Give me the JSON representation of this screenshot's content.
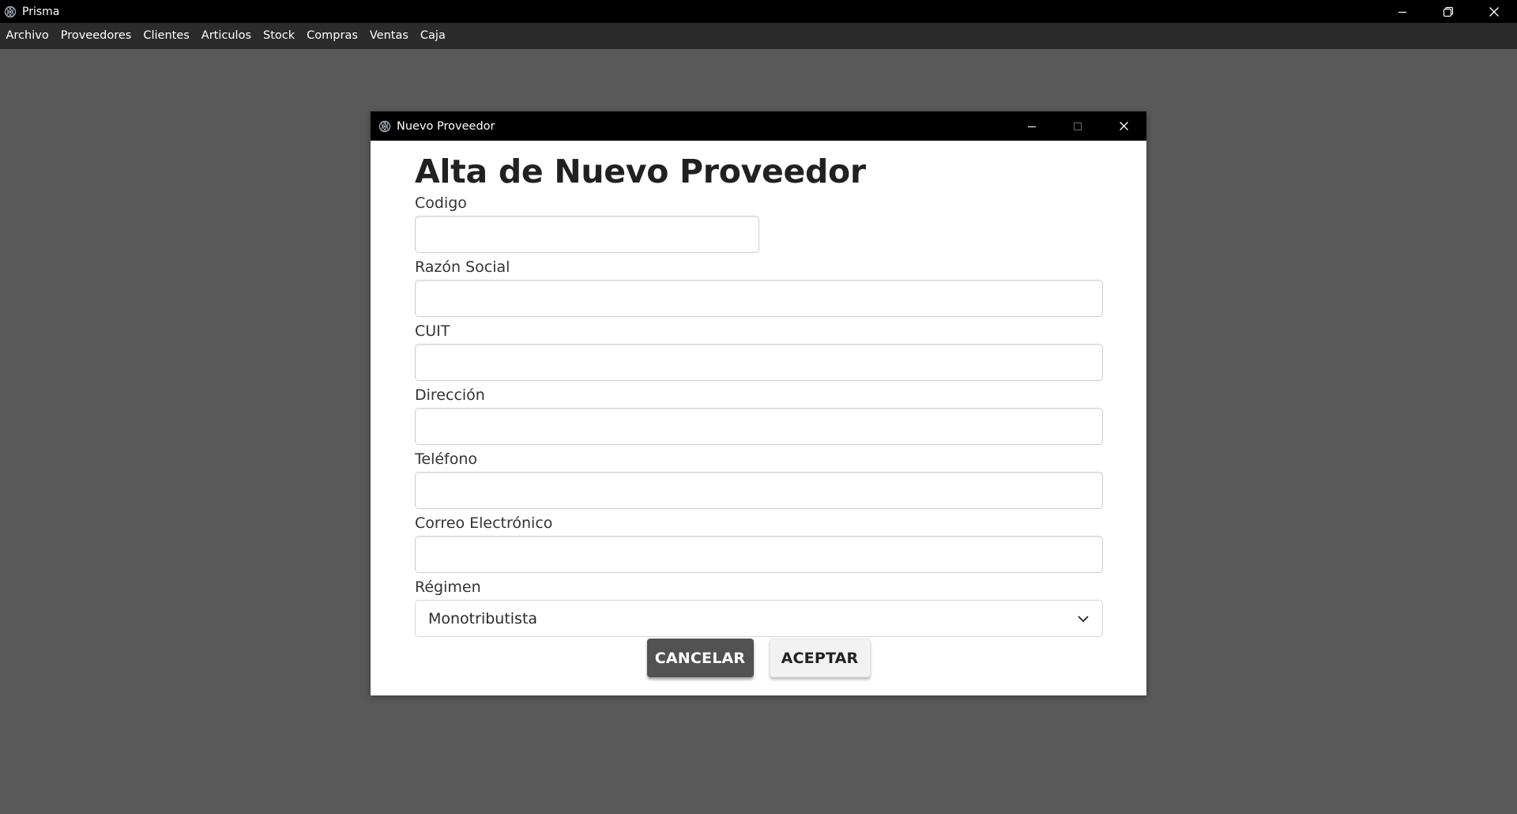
{
  "app": {
    "title": "Prisma"
  },
  "menu": {
    "items": [
      "Archivo",
      "Proveedores",
      "Clientes",
      "Articulos",
      "Stock",
      "Compras",
      "Ventas",
      "Caja"
    ]
  },
  "dialog": {
    "title": "Nuevo Proveedor",
    "heading": "Alta de Nuevo Proveedor",
    "fields": {
      "codigo": {
        "label": "Codigo",
        "value": ""
      },
      "razon_social": {
        "label": "Razón Social",
        "value": ""
      },
      "cuit": {
        "label": "CUIT",
        "value": ""
      },
      "direccion": {
        "label": "Dirección",
        "value": ""
      },
      "telefono": {
        "label": "Teléfono",
        "value": ""
      },
      "correo": {
        "label": "Correo Electrónico",
        "value": ""
      },
      "regimen": {
        "label": "Régimen",
        "value": "Monotributista"
      }
    },
    "buttons": {
      "cancel": "CANCELAR",
      "accept": "ACEPTAR"
    }
  },
  "colors": {
    "titlebar": "#000000",
    "menubar": "#2b2b2b",
    "background": "#595959",
    "cancel_button": "#525252",
    "accept_button": "#f2f2f2"
  },
  "icons": [
    "app-logo-icon",
    "minimize-icon",
    "restore-icon",
    "maximize-icon",
    "close-icon",
    "chevron-down-icon"
  ]
}
